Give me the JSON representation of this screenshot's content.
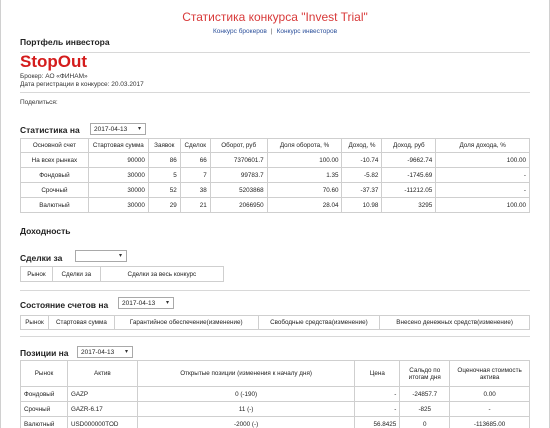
{
  "site": {
    "title": "Статистика конкурса \"Invest Trial\"",
    "nav": [
      "Конкурс брокеров",
      "Конкурс инвесторов"
    ],
    "nav_sep": "|"
  },
  "page": {
    "heading": "Портфель инвестора",
    "investor_name": "StopOut",
    "broker": "Брокер: АО «ФИНАМ»",
    "registered": "Дата регистрации в конкурсе: 20.03.2017",
    "share": "Поделиться:"
  },
  "stats": {
    "label": "Статистика на",
    "date": "2017-04-13",
    "headers": [
      "Основной счет",
      "Стартовая сумма",
      "Заявок",
      "Сделок",
      "Оборот, руб",
      "Доля оборота, %",
      "Доход, %",
      "Доход, руб",
      "Доля дохода, %"
    ],
    "rows": [
      [
        "На всех рынках",
        "90000",
        "86",
        "66",
        "7370601.7",
        "100.00",
        "-10.74",
        "-9662.74",
        "100.00"
      ],
      [
        "Фондовый",
        "30000",
        "5",
        "7",
        "99783.7",
        "1.35",
        "-5.82",
        "-1745.69",
        "-"
      ],
      [
        "Срочный",
        "30000",
        "52",
        "38",
        "5203868",
        "70.60",
        "-37.37",
        "-11212.05",
        "-"
      ],
      [
        "Валютный",
        "30000",
        "29",
        "21",
        "2066950",
        "28.04",
        "10.98",
        "3295",
        "100.00"
      ]
    ]
  },
  "income": {
    "label": "Доходность"
  },
  "deals": {
    "label": "Сделки за",
    "value": "",
    "headers": [
      "Рынок",
      "Сделки за",
      "Сделки за весь конкурс"
    ]
  },
  "accounts": {
    "label": "Состояние счетов на",
    "date": "2017-04-13",
    "headers": [
      "Рынок",
      "Стартовая сумма",
      "Гарантийное обеспечение(изменение)",
      "Свободные средства(изменение)",
      "Внесено денежных средств(изменение)"
    ]
  },
  "positions": {
    "label": "Позиции на",
    "date": "2017-04-13",
    "headers": [
      "Рынок",
      "Актив",
      "Открытые позиции (изменения к началу дня)",
      "Цена",
      "Сальдо по итогам дня",
      "Оценочная стоимость актива"
    ],
    "rows": [
      [
        "Фондовый",
        "GAZP",
        "0 (-190)",
        "-",
        "-24857.7",
        "0.00"
      ],
      [
        "Срочный",
        "GAZR-6.17",
        "11 (-)",
        "-",
        "-825",
        "-"
      ],
      [
        "Валютный",
        "USD000000TOD",
        "-2000 (-)",
        "56.8425",
        "0",
        "-113685.00"
      ]
    ]
  }
}
